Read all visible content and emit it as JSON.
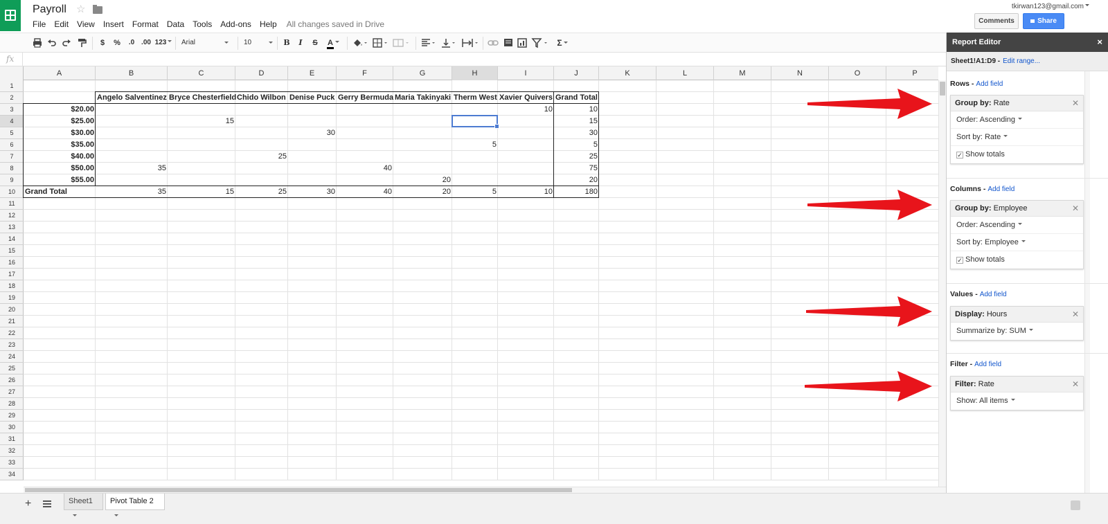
{
  "app": {
    "title": "Payroll",
    "saved_status": "All changes saved in Drive",
    "user_email": "tkirwan123@gmail.com",
    "comments_label": "Comments",
    "share_label": "Share"
  },
  "menu": [
    "File",
    "Edit",
    "View",
    "Insert",
    "Format",
    "Data",
    "Tools",
    "Add-ons",
    "Help"
  ],
  "toolbar": {
    "currency": "$",
    "percent": "%",
    "dec_less": ".0",
    "dec_more": ".00",
    "more_formats": "123",
    "font": "Arial",
    "font_size": "10",
    "bold": "B",
    "italic": "I",
    "strike": "S",
    "text_color": "A",
    "sum": "Σ"
  },
  "formula_bar": {
    "fx_label": "fx",
    "value": ""
  },
  "columns": [
    "A",
    "B",
    "C",
    "D",
    "E",
    "F",
    "G",
    "H",
    "I",
    "J",
    "K",
    "L",
    "M",
    "N",
    "O",
    "P"
  ],
  "rows": [
    "1",
    "2",
    "3",
    "4",
    "5",
    "6",
    "7",
    "8",
    "9",
    "10",
    "11",
    "12",
    "13",
    "14",
    "15",
    "16",
    "17",
    "18",
    "19",
    "20",
    "21",
    "22",
    "23",
    "24",
    "25",
    "26",
    "27",
    "28",
    "29",
    "30",
    "31",
    "32",
    "33",
    "34"
  ],
  "pivot": {
    "headers": [
      "Angelo Salventinez",
      "Bryce Chesterfield",
      "Chido Wilbon",
      "Denise Puck",
      "Gerry Bermuda",
      "Maria Takinyaki",
      "Therm West",
      "Xavier Quivers",
      "Grand Total"
    ],
    "row_labels": [
      "$20.00",
      "$25.00",
      "$30.00",
      "$35.00",
      "$40.00",
      "$50.00",
      "$55.00",
      "Grand Total"
    ],
    "values": [
      [
        "",
        "",
        "",
        "",
        "",
        "",
        "",
        "10",
        "10"
      ],
      [
        "",
        "15",
        "",
        "",
        "",
        "",
        "",
        "",
        "15"
      ],
      [
        "",
        "",
        "",
        "30",
        "",
        "",
        "",
        "",
        "30"
      ],
      [
        "",
        "",
        "",
        "",
        "",
        "",
        "5",
        "",
        "5"
      ],
      [
        "",
        "",
        "25",
        "",
        "",
        "",
        "",
        "",
        "25"
      ],
      [
        "35",
        "",
        "",
        "",
        "40",
        "",
        "",
        "",
        "75"
      ],
      [
        "",
        "",
        "",
        "",
        "",
        "20",
        "",
        "",
        "20"
      ],
      [
        "35",
        "15",
        "25",
        "30",
        "40",
        "20",
        "5",
        "10",
        "180"
      ]
    ]
  },
  "sheets": {
    "tab1": "Sheet1",
    "tab2": "Pivot Table 2",
    "add": "+"
  },
  "report_editor": {
    "title": "Report Editor",
    "close": "×",
    "range": "Sheet1!A1:D9 -",
    "edit_range": "Edit range...",
    "add_field": "Add field",
    "rows": {
      "label": "Rows -",
      "group_by_key": "Group by:",
      "group_by_value": "Rate",
      "order": "Order: Ascending",
      "sort_by": "Sort by: Rate",
      "show_totals": "Show totals"
    },
    "columns": {
      "label": "Columns -",
      "group_by_key": "Group by:",
      "group_by_value": "Employee",
      "order": "Order: Ascending",
      "sort_by": "Sort by: Employee",
      "show_totals": "Show totals"
    },
    "values": {
      "label": "Values -",
      "display_key": "Display:",
      "display_value": "Hours",
      "summarize": "Summarize by: SUM"
    },
    "filter": {
      "label": "Filter -",
      "filter_key": "Filter:",
      "filter_value": "Rate",
      "show": "Show: All items"
    }
  },
  "colors": {
    "brand_green": "#0f9d58",
    "share_blue": "#4a8bf5",
    "arrow_red": "#e8141b",
    "editor_header": "#444444"
  }
}
